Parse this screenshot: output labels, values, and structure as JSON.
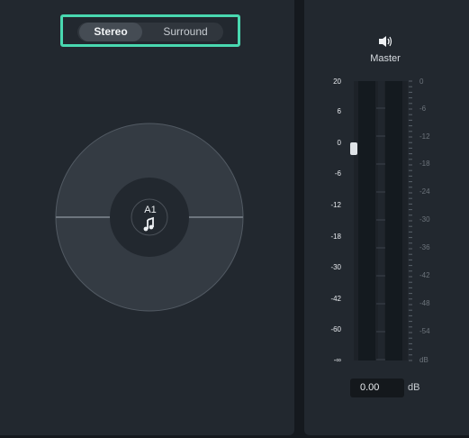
{
  "mode": {
    "stereo": "Stereo",
    "surround": "Surround"
  },
  "master": {
    "label": "Master",
    "icon": "speaker-icon"
  },
  "pan": {
    "channel": "A1",
    "icon": "music-note-icon"
  },
  "meter": {
    "left_ticks": [
      "20",
      "6",
      "0",
      "-6",
      "-12",
      "-18",
      "-30",
      "-42",
      "-60",
      "-∞"
    ],
    "right_ticks": [
      "0",
      "-6",
      "-12",
      "-18",
      "-24",
      "-30",
      "-36",
      "-42",
      "-48",
      "-54",
      "dB"
    ],
    "volume_value": "0.00",
    "unit": "dB"
  },
  "colors": {
    "accent": "#49d8b0",
    "panel": "#22282f",
    "background": "#15191e"
  }
}
